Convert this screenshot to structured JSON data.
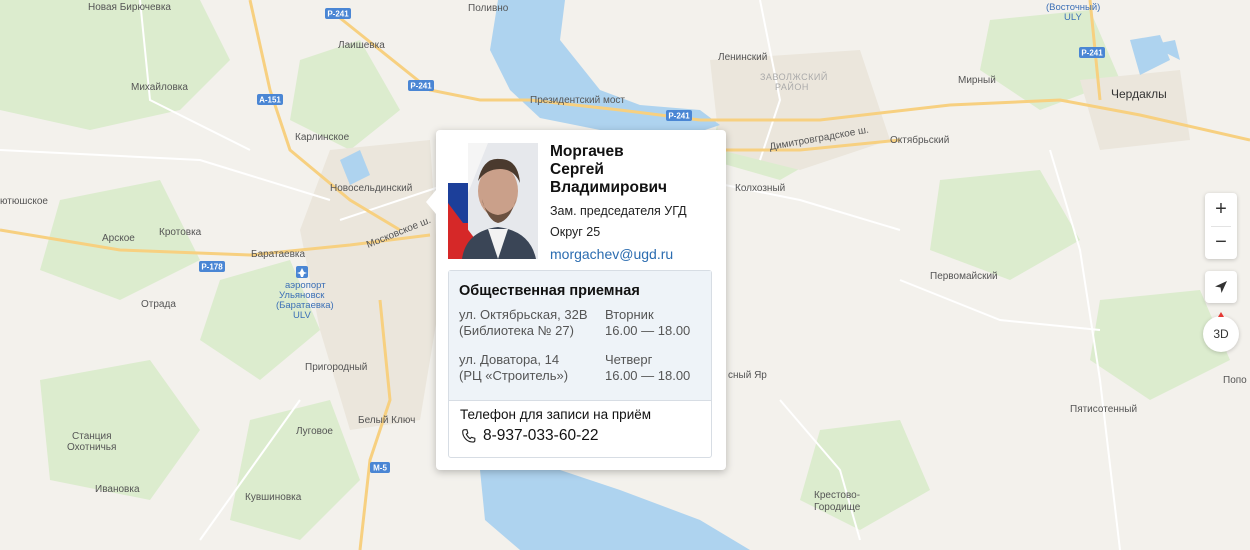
{
  "map": {
    "places": [
      {
        "id": "novaya-biryuchevka",
        "text": "Новая Бирючевка"
      },
      {
        "id": "polivno",
        "text": "Поливно"
      },
      {
        "id": "vostochny",
        "text": "(Восточный)"
      },
      {
        "id": "vostochny-code",
        "text": "ULY"
      },
      {
        "id": "laishevka",
        "text": "Лаишевка"
      },
      {
        "id": "mikhailovka",
        "text": "Михайловка"
      },
      {
        "id": "leninsky",
        "text": "Ленинский"
      },
      {
        "id": "zavolzhsky-1",
        "text": "ЗАВОЛЖСКИЙ"
      },
      {
        "id": "zavolzhsky-2",
        "text": "РАЙОН"
      },
      {
        "id": "mirny",
        "text": "Мирный"
      },
      {
        "id": "cherdakly",
        "text": "Чердаклы"
      },
      {
        "id": "prezidentsky-most",
        "text": "Президентский мост"
      },
      {
        "id": "karlinskoe",
        "text": "Карлинское"
      },
      {
        "id": "oktyabrsky",
        "text": "Октябрьский"
      },
      {
        "id": "dimitrovgradskoe",
        "text": "Димитровградское ш."
      },
      {
        "id": "novoseldinsky",
        "text": "Новосельдинский"
      },
      {
        "id": "kolkhozny",
        "text": "Колхозный"
      },
      {
        "id": "yushskoe",
        "text": "ютюшское"
      },
      {
        "id": "moskovskoe",
        "text": "Московское ш."
      },
      {
        "id": "arskoe",
        "text": "Арское"
      },
      {
        "id": "krotovka",
        "text": "Кротовка"
      },
      {
        "id": "barataevka",
        "text": "Баратаевка"
      },
      {
        "id": "pervomaisky",
        "text": "Первомайский"
      },
      {
        "id": "airport-1",
        "text": "аэропорт"
      },
      {
        "id": "airport-2",
        "text": "Ульяновск"
      },
      {
        "id": "airport-3",
        "text": "(Баратаевка)"
      },
      {
        "id": "airport-4",
        "text": "ULV"
      },
      {
        "id": "otradnaya",
        "text": "Отрада"
      },
      {
        "id": "prigorodny",
        "text": "Пригородный"
      },
      {
        "id": "krasny-yar",
        "text": "сный Яр"
      },
      {
        "id": "popo",
        "text": "Попо"
      },
      {
        "id": "bely-klyuch",
        "text": "Белый Ключ"
      },
      {
        "id": "pyatisotenny",
        "text": "Пятисотенный"
      },
      {
        "id": "lugovoe",
        "text": "Луговое"
      },
      {
        "id": "stantsiya-1",
        "text": "Станция"
      },
      {
        "id": "stantsiya-2",
        "text": "Охотничья"
      },
      {
        "id": "ivanovka",
        "text": "Ивановка"
      },
      {
        "id": "kuvshinovka",
        "text": "Кувшиновка"
      },
      {
        "id": "krestovo-1",
        "text": "Крестово-"
      },
      {
        "id": "krestovo-2",
        "text": "Городище"
      }
    ],
    "road_signs": [
      {
        "id": "p241-a",
        "text": "Р-241"
      },
      {
        "id": "p241-b",
        "text": "Р-241"
      },
      {
        "id": "p241-c",
        "text": "Р-241"
      },
      {
        "id": "p241-d",
        "text": "Р-241"
      },
      {
        "id": "a151",
        "text": "А-151"
      },
      {
        "id": "p178",
        "text": "Р-178"
      },
      {
        "id": "m5",
        "text": "М-5"
      }
    ],
    "colors": {
      "land": "#f3f1ec",
      "water": "#aed3ef",
      "forest": "#d9ebc9",
      "road_major": "#f8d27a",
      "road_minor": "#ffffff",
      "urban": "#ebe6dd"
    }
  },
  "popup": {
    "name_line1": "Моргачев",
    "name_line2": "Сергей",
    "name_line3": "Владимирович",
    "role": "Зам. председателя УГД",
    "district": "Округ 25",
    "email": "morgachev@ugd.ru",
    "office": {
      "title": "Общественная приемная",
      "rows": [
        {
          "address_1": "ул. Октябрьская, 32В",
          "address_2": "(Библиотека № 27)",
          "day": "Вторник",
          "time": "16.00 — 18.00"
        },
        {
          "address_1": "ул. Доватора, 14",
          "address_2": "(РЦ «Строитель»)",
          "day": "Четверг",
          "time": "16.00 — 18.00"
        }
      ]
    },
    "phone_caption": "Телефон для записи на приём",
    "phone": "8-937-033-60-22",
    "phone_icon": "phone-icon"
  },
  "controls": {
    "zoom_in": "+",
    "zoom_out": "−",
    "locate_icon": "location-arrow-icon",
    "mode_3d": "3D"
  }
}
